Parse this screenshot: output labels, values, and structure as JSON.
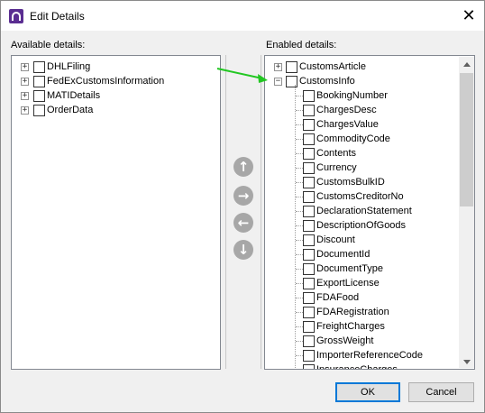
{
  "window": {
    "title": "Edit Details",
    "close_symbol": "✕"
  },
  "available": {
    "label": "Available details:",
    "items": [
      {
        "label": "DHLFiling"
      },
      {
        "label": "FedExCustomsInformation"
      },
      {
        "label": "MATIDetails"
      },
      {
        "label": "OrderData"
      }
    ]
  },
  "enabled": {
    "label": "Enabled details:",
    "items": [
      {
        "label": "CustomsArticle",
        "expander": "+"
      },
      {
        "label": "CustomsInfo",
        "expander": "−"
      }
    ],
    "children": [
      "BookingNumber",
      "ChargesDesc",
      "ChargesValue",
      "CommodityCode",
      "Contents",
      "Currency",
      "CustomsBulkID",
      "CustomsCreditorNo",
      "DeclarationStatement",
      "DescriptionOfGoods",
      "Discount",
      "DocumentId",
      "DocumentType",
      "ExportLicense",
      "FDAFood",
      "FDARegistration",
      "FreightCharges",
      "GrossWeight",
      "ImporterReferenceCode",
      "InsuranceCharges"
    ]
  },
  "move_buttons": {
    "up": "↑",
    "right": "→",
    "left": "←",
    "down": "↓"
  },
  "buttons": {
    "ok": "OK",
    "cancel": "Cancel"
  },
  "colors": {
    "accent": "#0078d7",
    "arrow_annotation": "#22c722",
    "app_icon": "#5a2d91"
  }
}
